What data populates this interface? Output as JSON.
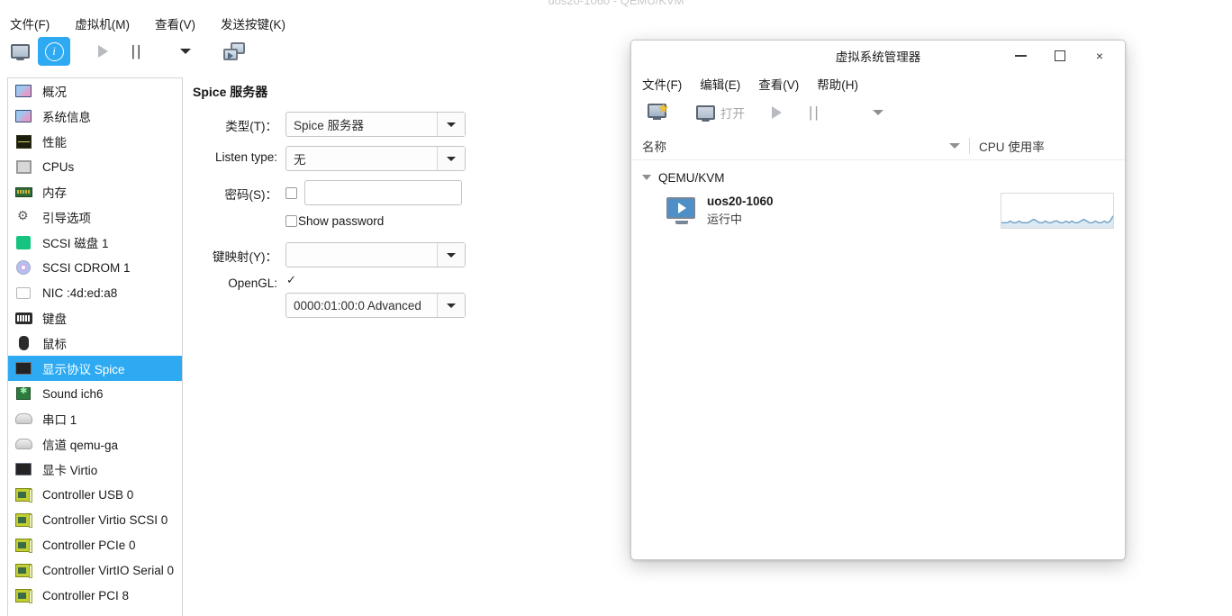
{
  "ghost_title": "uos20-1060 - QEMU/KVM",
  "details_window": {
    "menubar": [
      {
        "label": "文件(F)",
        "name": "menu-file"
      },
      {
        "label": "虚拟机(M)",
        "name": "menu-virtualmachine"
      },
      {
        "label": "查看(V)",
        "name": "menu-view"
      },
      {
        "label": "发送按键(K)",
        "name": "menu-sendkey"
      }
    ],
    "toolbar": {
      "console_tooltip": "console",
      "details_tooltip": "details",
      "run_tooltip": "run",
      "pause_tooltip": "pause",
      "dropdown_tooltip": "more",
      "snapshot_tooltip": "snapshots"
    },
    "sidebar": {
      "items": [
        {
          "label": "概况",
          "icon": "overview-icon"
        },
        {
          "label": "系统信息",
          "icon": "osinfo-icon"
        },
        {
          "label": "性能",
          "icon": "performance-icon"
        },
        {
          "label": "CPUs",
          "icon": "cpu-icon"
        },
        {
          "label": "内存",
          "icon": "memory-icon"
        },
        {
          "label": "引导选项",
          "icon": "boot-options-icon"
        },
        {
          "label": "SCSI 磁盘 1",
          "icon": "disk-icon"
        },
        {
          "label": "SCSI CDROM 1",
          "icon": "cdrom-icon"
        },
        {
          "label": "NIC :4d:ed:a8",
          "icon": "nic-icon"
        },
        {
          "label": "键盘",
          "icon": "keyboard-icon"
        },
        {
          "label": "鼠标",
          "icon": "mouse-icon"
        },
        {
          "label": "显示协议 Spice",
          "icon": "display-icon",
          "selected": true
        },
        {
          "label": "Sound ich6",
          "icon": "sound-icon"
        },
        {
          "label": "串口 1",
          "icon": "serial-icon"
        },
        {
          "label": "信道 qemu-ga",
          "icon": "channel-icon"
        },
        {
          "label": "显卡 Virtio",
          "icon": "video-icon"
        },
        {
          "label": "Controller USB 0",
          "icon": "controller-icon"
        },
        {
          "label": "Controller Virtio SCSI 0",
          "icon": "controller-icon"
        },
        {
          "label": "Controller PCIe 0",
          "icon": "controller-icon"
        },
        {
          "label": "Controller VirtIO Serial 0",
          "icon": "controller-icon"
        },
        {
          "label": "Controller PCI 8",
          "icon": "controller-icon"
        }
      ],
      "selected_color": "#2eaaf2"
    },
    "detail_panel": {
      "heading": "Spice 服务器",
      "type_label": "类型(T)：",
      "type_value": "Spice 服务器",
      "listen_type_label": "Listen type:",
      "listen_type_value": "无",
      "password_label": "密码(S)：",
      "password_value": "",
      "password_enabled": false,
      "show_password_label": "Show password",
      "show_password_checked": false,
      "keymap_label": "键映射(Y)：",
      "keymap_value": "",
      "opengl_label": "OpenGL:",
      "opengl_checked": true,
      "opengl_device_value": "0000:01:00:0 Advanced"
    }
  },
  "vmm_window": {
    "title": "虚拟系统管理器",
    "window_controls": {
      "minimize": "minimize-icon",
      "maximize": "maximize-icon",
      "close": "×"
    },
    "menubar": [
      {
        "label": "文件(F)",
        "name": "vmm-menu-file"
      },
      {
        "label": "编辑(E)",
        "name": "vmm-menu-edit"
      },
      {
        "label": "查看(V)",
        "name": "vmm-menu-view"
      },
      {
        "label": "帮助(H)",
        "name": "vmm-menu-help"
      }
    ],
    "toolbar": {
      "new_vm_tooltip": "新建虚拟机",
      "open_label": "打开",
      "run_tooltip": "run",
      "pause_tooltip": "pause",
      "dropdown_tooltip": "more"
    },
    "columns": {
      "name": "名称",
      "cpu_usage": "CPU 使用率"
    },
    "tree": {
      "connection": "QEMU/KVM",
      "vms": [
        {
          "name": "uos20-1060",
          "state": "运行中",
          "sparkline": [
            3,
            3,
            3,
            4,
            3,
            3,
            4,
            3,
            3,
            3,
            4,
            5,
            4,
            3,
            3,
            4,
            3,
            3,
            4,
            4,
            3,
            3,
            4,
            3,
            4,
            3,
            3,
            4,
            5,
            4,
            3,
            3,
            4,
            3,
            3,
            4,
            3,
            4,
            7
          ],
          "line_color": "#6f9fc4"
        }
      ]
    }
  }
}
